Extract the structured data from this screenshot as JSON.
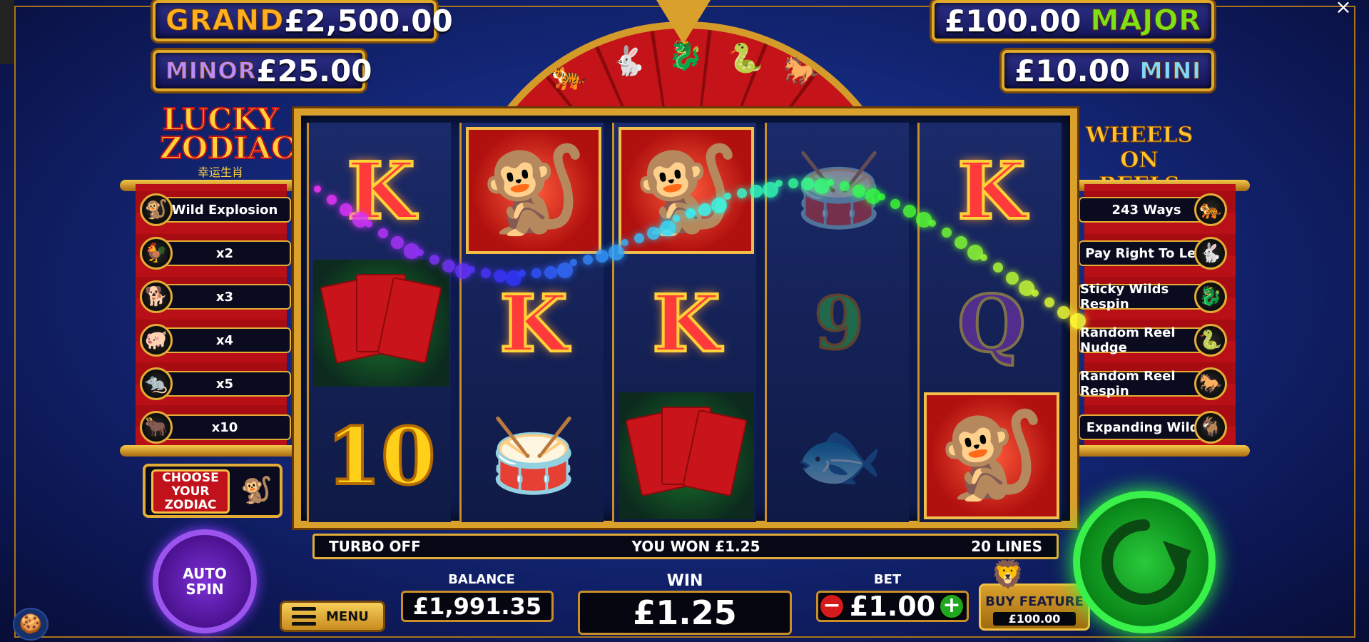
{
  "jackpots": {
    "grand": {
      "name": "GRAND",
      "value": "£2,500.00"
    },
    "minor": {
      "name": "MINOR",
      "value": "£25.00"
    },
    "major": {
      "name": "MAJOR",
      "value": "£100.00"
    },
    "mini": {
      "name": "MINI",
      "value": "£10.00"
    }
  },
  "logos": {
    "game_title_line1": "LUCKY",
    "game_title_line2": "ZODIAC",
    "game_title_chinese": "幸运生肖",
    "feature_logo": "WHEELS ON REELS"
  },
  "left_features": [
    {
      "label": "Wild Explosion",
      "icon": "monkey-icon"
    },
    {
      "label": "x2",
      "icon": "rooster-icon"
    },
    {
      "label": "x3",
      "icon": "dog-icon"
    },
    {
      "label": "x4",
      "icon": "pig-icon"
    },
    {
      "label": "x5",
      "icon": "rat-icon"
    },
    {
      "label": "x10",
      "icon": "ox-icon"
    }
  ],
  "right_features": [
    {
      "label": "243 Ways",
      "icon": "tiger-icon"
    },
    {
      "label": "Pay Right To Left",
      "icon": "rabbit-icon"
    },
    {
      "label": "Sticky Wilds Respin",
      "icon": "dragon-icon"
    },
    {
      "label": "Random Reel Nudge",
      "icon": "snake-icon"
    },
    {
      "label": "Random Reel Respin",
      "icon": "horse-icon"
    },
    {
      "label": "Expanding Wilds",
      "icon": "goat-icon"
    }
  ],
  "choose_zodiac": {
    "label": "CHOOSE YOUR ZODIAC"
  },
  "reels": [
    [
      "K",
      "envelopes",
      "10"
    ],
    [
      "monkey",
      "K",
      "drum"
    ],
    [
      "monkey",
      "K",
      "envelopes"
    ],
    [
      "drum",
      "9",
      "koi"
    ],
    [
      "K",
      "Q",
      "monkey"
    ]
  ],
  "status_strip": {
    "turbo": "TURBO OFF",
    "message": "YOU WON £1.25",
    "lines": "20 LINES"
  },
  "controls": {
    "auto_spin": "AUTO SPIN",
    "menu": "MENU",
    "balance_label": "BALANCE",
    "balance_value": "£1,991.35",
    "win_label": "WIN",
    "win_value": "£1.25",
    "bet_label": "BET",
    "bet_value": "£1.00",
    "buy_feature_label": "BUY FEATURE",
    "buy_feature_price": "£100.00"
  },
  "colors": {
    "spin_button": "#1fbf2f",
    "auto_spin_button": "#7b2fd6",
    "accent_gold": "#e2ac36",
    "reel_red": "#c1121b"
  }
}
